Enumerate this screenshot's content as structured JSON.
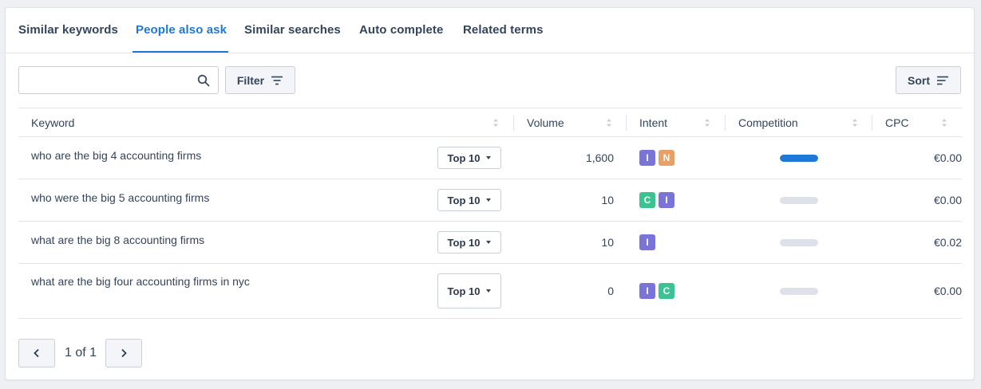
{
  "tabs": [
    {
      "label": "Similar keywords",
      "active": false
    },
    {
      "label": "People also ask",
      "active": true
    },
    {
      "label": "Similar searches",
      "active": false
    },
    {
      "label": "Auto complete",
      "active": false
    },
    {
      "label": "Related terms",
      "active": false
    }
  ],
  "toolbar": {
    "search_value": "",
    "filter_label": "Filter",
    "sort_label": "Sort"
  },
  "table": {
    "headers": {
      "keyword": "Keyword",
      "volume": "Volume",
      "intent": "Intent",
      "competition": "Competition",
      "cpc": "CPC"
    },
    "rows": [
      {
        "keyword": "who are the big 4 accounting firms",
        "rank": "Top 10",
        "volume": "1,600",
        "intents": [
          "I",
          "N"
        ],
        "competition": 1.0,
        "cpc": "€0.00"
      },
      {
        "keyword": "who were the big 5 accounting firms",
        "rank": "Top 10",
        "volume": "10",
        "intents": [
          "C",
          "I"
        ],
        "competition": 0.0,
        "cpc": "€0.00"
      },
      {
        "keyword": "what are the big 8 accounting firms",
        "rank": "Top 10",
        "volume": "10",
        "intents": [
          "I"
        ],
        "competition": 0.0,
        "cpc": "€0.02"
      },
      {
        "keyword": "what are the big four accounting firms in nyc",
        "rank": "Top 10",
        "volume": "0",
        "intents": [
          "I",
          "C"
        ],
        "competition": 0.0,
        "cpc": "€0.00"
      }
    ]
  },
  "intent_colors": {
    "I": "#7b74d8",
    "N": "#e8a06a",
    "C": "#3cc394"
  },
  "pagination": {
    "info": "1 of 1"
  }
}
